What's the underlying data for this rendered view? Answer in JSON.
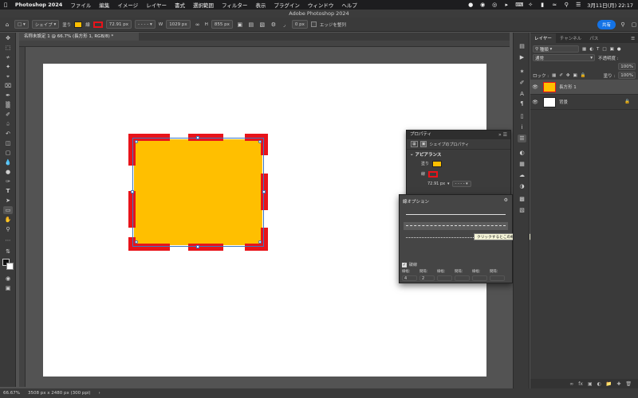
{
  "menubar": {
    "app_name": "Photoshop 2024",
    "items": [
      "ファイル",
      "編集",
      "イメージ",
      "レイヤー",
      "書式",
      "選択範囲",
      "フィルター",
      "表示",
      "プラグイン",
      "ウィンドウ",
      "ヘルプ"
    ],
    "clock": "3月11日(月)  22:17"
  },
  "window": {
    "title": "Adobe Photoshop 2024"
  },
  "options_bar": {
    "tool_mode": "シェイプ",
    "fill_label": "塗り",
    "stroke_label": "線",
    "stroke_width": "72.91 px",
    "w_label": "W",
    "w_value": "1029 px",
    "h_label": "H",
    "h_value": "855 px",
    "corner_radius": "0 px",
    "edge_align_label": "エッジを整列",
    "share_label": "共有",
    "fill_color": "#ffbf00",
    "stroke_color": "#e8131a"
  },
  "document": {
    "tab_title": "名称未設定 1 @ 66.7% (長方形 1, RGB/8) *"
  },
  "status_bar": {
    "zoom": "66.67%",
    "doc_info": "3508 px x 2480 px (300 ppi)"
  },
  "layers_panel": {
    "tabs": [
      "レイヤー",
      "チャンネル",
      "パス"
    ],
    "filter_label": "種類",
    "blend_mode": "通常",
    "opacity_label": "不透明度 :",
    "opacity_value": "100%",
    "lock_label": "ロック :",
    "fill_label": "塗り :",
    "fill_value": "100%",
    "layers": [
      {
        "name": "長方形 1",
        "selected": true,
        "thumb_color": "#ffbf00"
      },
      {
        "name": "背景",
        "selected": false,
        "thumb_color": "#ffffff"
      }
    ]
  },
  "properties_panel": {
    "title": "プロパティ",
    "subtitle": "シェイプのプロパティ",
    "section": "アピアランス",
    "fill_label": "塗り",
    "stroke_label": "線",
    "stroke_width": "72.91 px"
  },
  "stroke_options": {
    "title": "線オプション",
    "dashed_label": "破線",
    "dash_label": "線幅：",
    "gap_label": "間隔：",
    "dash_values": [
      "4",
      "2",
      "",
      "",
      "",
      ""
    ],
    "tooltip": "クリックするとこの線を適用"
  }
}
